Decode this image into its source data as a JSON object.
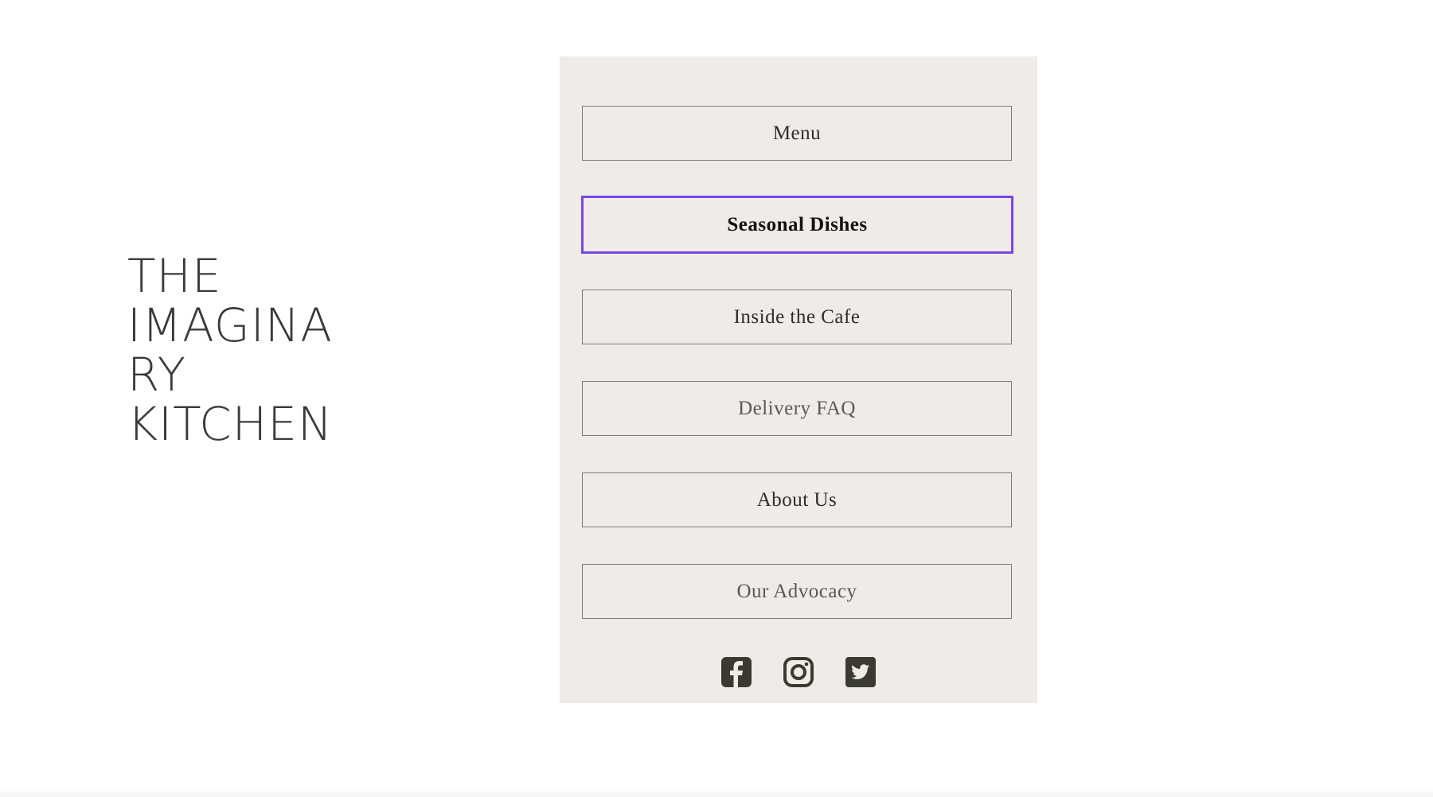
{
  "logo": {
    "line1": "THE",
    "line2": "IMAGINA",
    "line3": "RY",
    "line4": "KITCHEN"
  },
  "nav": {
    "items": [
      {
        "label": "Menu"
      },
      {
        "label": "Seasonal Dishes"
      },
      {
        "label": "Inside the Cafe"
      },
      {
        "label": "Delivery FAQ"
      },
      {
        "label": "About Us"
      },
      {
        "label": "Our Advocacy"
      }
    ],
    "active_index": 1
  },
  "social": {
    "icons": [
      "facebook-icon",
      "instagram-icon",
      "twitter-icon"
    ]
  },
  "colors": {
    "panel_bg": "#efebe7",
    "focus_outline": "#7a46e6",
    "icon_color": "#3a3a33",
    "text": "#2e2d2a"
  }
}
